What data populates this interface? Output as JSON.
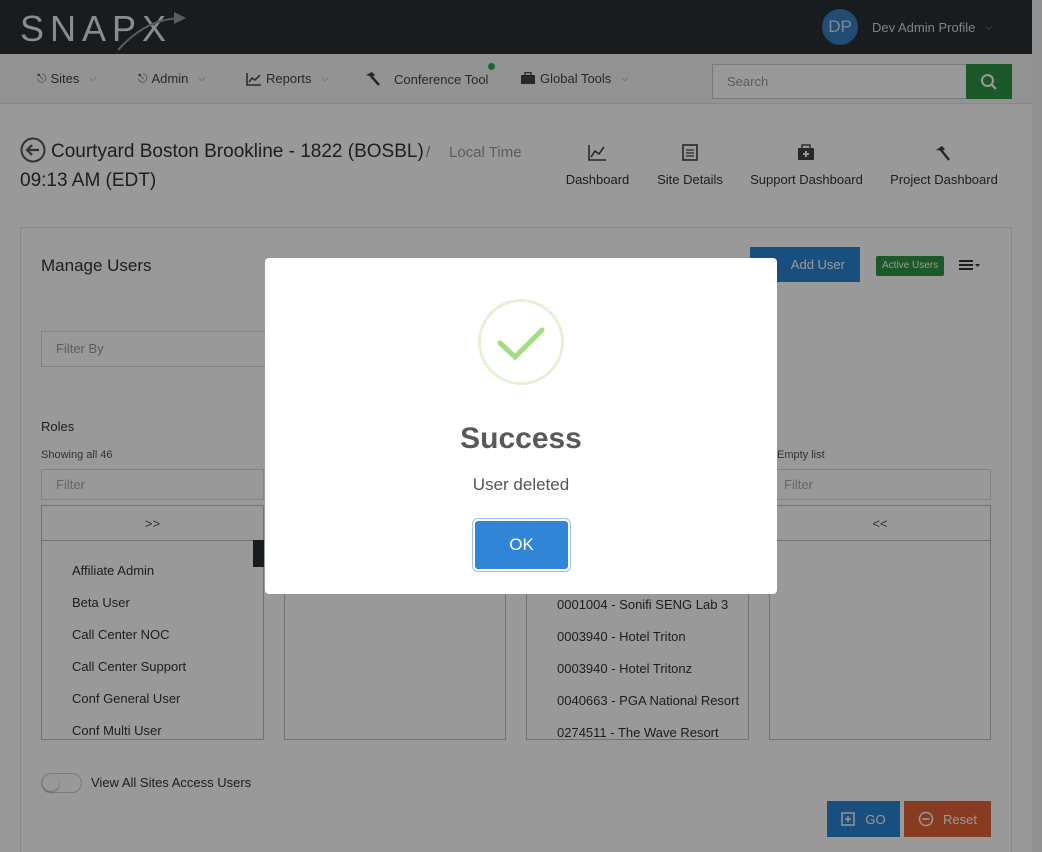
{
  "header": {
    "logo_text": "SNAPX",
    "avatar_initials": "DP",
    "profile_name": "Dev Admin Profile"
  },
  "nav": {
    "items": [
      {
        "label": "Sites",
        "icon": "sites-icon"
      },
      {
        "label": "Admin",
        "icon": "admin-icon"
      },
      {
        "label": "Reports",
        "icon": "chart-icon"
      },
      {
        "label": "Conference Tool",
        "icon": "hammer-icon"
      },
      {
        "label": "Global Tools",
        "icon": "briefcase-icon"
      }
    ],
    "search_placeholder": "Search"
  },
  "site": {
    "title": "Courtyard Boston Brookline - 1822 (BOSBL)",
    "separator": "/",
    "local_time_label": "Local Time",
    "time": "09:13 AM (EDT)",
    "links": [
      {
        "label": "Dashboard",
        "icon": "line-chart-icon"
      },
      {
        "label": "Site Details",
        "icon": "document-icon"
      },
      {
        "label": "Support Dashboard",
        "icon": "medkit-icon"
      },
      {
        "label": "Project Dashboard",
        "icon": "hammer-icon"
      }
    ]
  },
  "manage": {
    "title": "Manage Users",
    "add_user_label": "Add User",
    "active_users_badge": "Active Users",
    "filter_by_placeholder": "Filter By",
    "roles_label": "Roles",
    "showing_text": "Showing all 46",
    "empty_text": "Empty list",
    "filter_placeholder": "Filter",
    "move_all_right": ">>",
    "move_all_left": "<<",
    "roles": [
      "Affiliate Admin",
      "Beta User",
      "Call Center NOC",
      "Call Center Support",
      "Conf General User",
      "Conf Multi User"
    ],
    "sites": [
      "0001004 - Sonifi SENG Lab 3",
      "0003940 - Hotel Triton",
      "0003940 - Hotel Tritonz",
      "0040663 - PGA National Resort",
      "0274511 - The Wave Resort"
    ],
    "toggle_label": "View All Sites Access Users",
    "go_label": "GO",
    "reset_label": "Reset"
  },
  "modal": {
    "title": "Success",
    "message": "User deleted",
    "ok_label": "OK"
  },
  "colors": {
    "header_bg": "#2a2f33",
    "primary": "#2b84d2",
    "success": "#2e9346",
    "danger": "#e2643a",
    "check": "#a5dc86"
  }
}
